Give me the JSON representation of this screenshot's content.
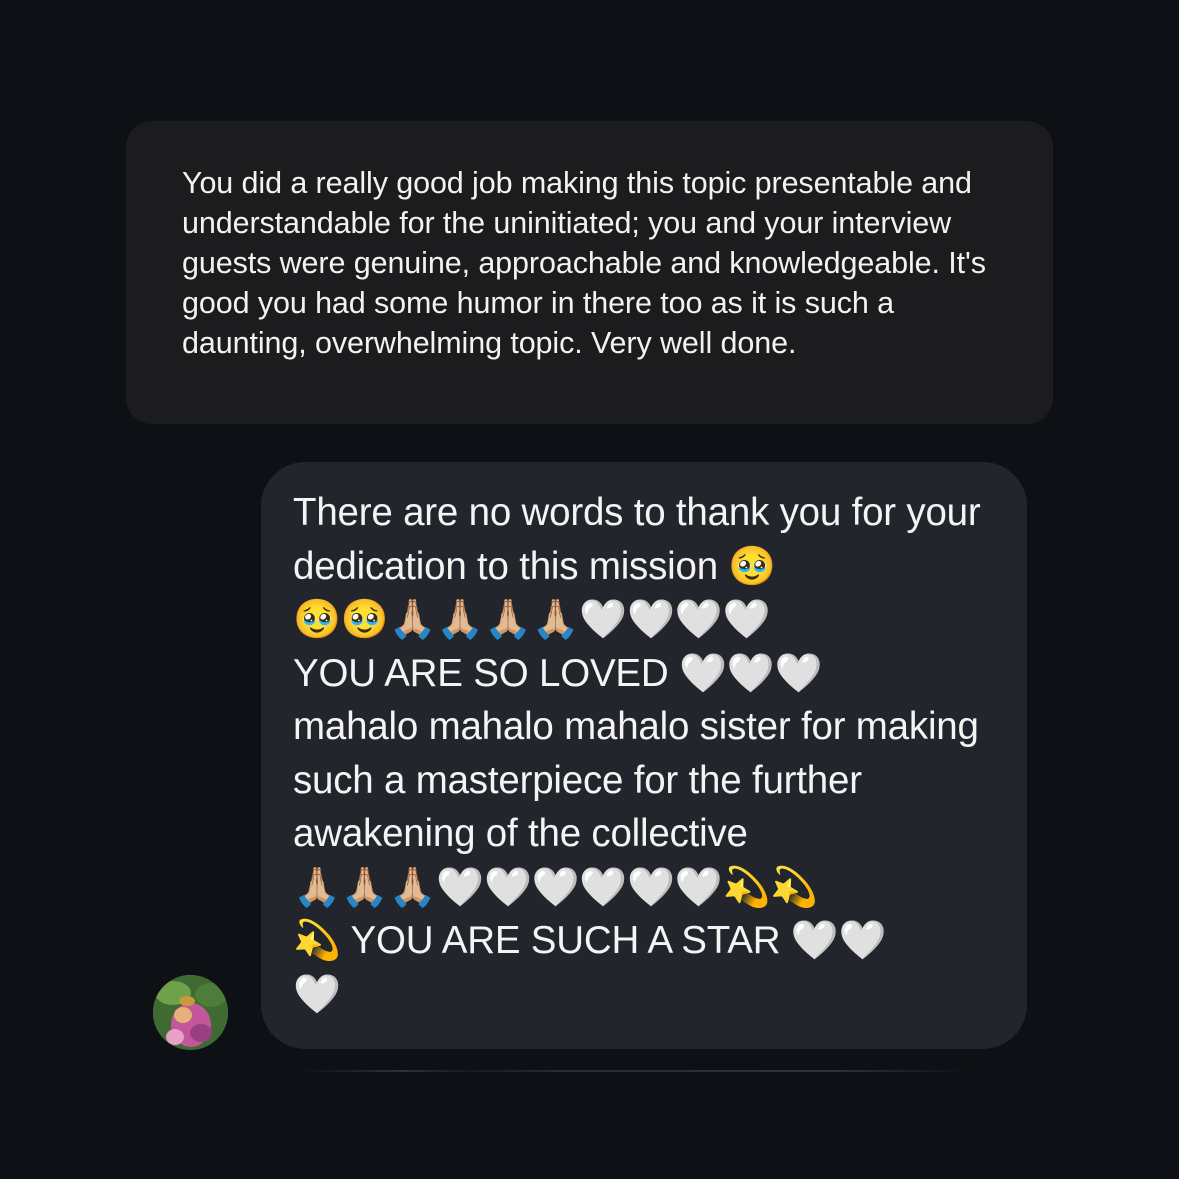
{
  "messages": {
    "received": {
      "text": "You did a really good job making this topic presentable and understandable for the uninitiated; you and your interview guests were genuine, approachable and knowledgeable. It's good you had some humor in there too as it is such a daunting, overwhelming topic. Very well done."
    },
    "reply": {
      "text": "There are no words to thank you for your dedication to this mission 🥹\n🥹🥹🙏🏼🙏🏼🙏🏼🙏🏼🤍🤍🤍🤍\nYOU ARE SO LOVED 🤍🤍🤍\nmahalo mahalo mahalo sister for making such a masterpiece for the further awakening of the collective\n🙏🏼🙏🏼🙏🏼🤍🤍🤍🤍🤍🤍💫💫\n💫 YOU ARE SUCH A STAR 🤍🤍\n🤍",
      "avatar_icon": "profile-avatar"
    }
  },
  "colors": {
    "background": "#0d1014",
    "received_bubble": "#1c1c1e",
    "reply_bubble": "#22252b"
  }
}
